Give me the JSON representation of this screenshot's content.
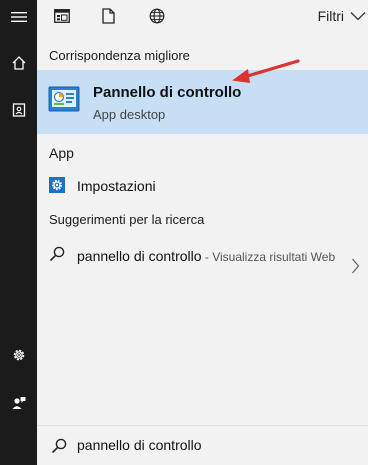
{
  "colors": {
    "rail_bg": "#1b1b1b",
    "panel_bg": "#f2f2f2",
    "selected_bg": "#c7dff5",
    "gear_blue": "#1f6fc5",
    "arrow_red": "#e03131"
  },
  "rail": {
    "items": [
      {
        "icon": "hamburger-menu-icon"
      },
      {
        "icon": "home-icon"
      },
      {
        "icon": "notebook-icon"
      },
      {
        "icon": "settings-gear-icon"
      },
      {
        "icon": "feedback-person-icon"
      }
    ]
  },
  "toolbar": {
    "icons": [
      "apps-filter-icon",
      "documents-filter-icon",
      "web-filter-icon"
    ],
    "filters_label": "Filtri"
  },
  "results": {
    "best_match_heading": "Corrispondenza migliore",
    "best_match": {
      "title": "Pannello di controllo",
      "subtitle": "App desktop",
      "icon": "control-panel-icon"
    },
    "app_heading": "App",
    "app_item": {
      "label": "Impostazioni",
      "icon": "gear-icon"
    },
    "suggestions_heading": "Suggerimenti per la ricerca",
    "suggestion": {
      "query": "pannello di controllo",
      "hint": " - Visualizza risultati Web"
    }
  },
  "search": {
    "value": "pannello di controllo"
  }
}
